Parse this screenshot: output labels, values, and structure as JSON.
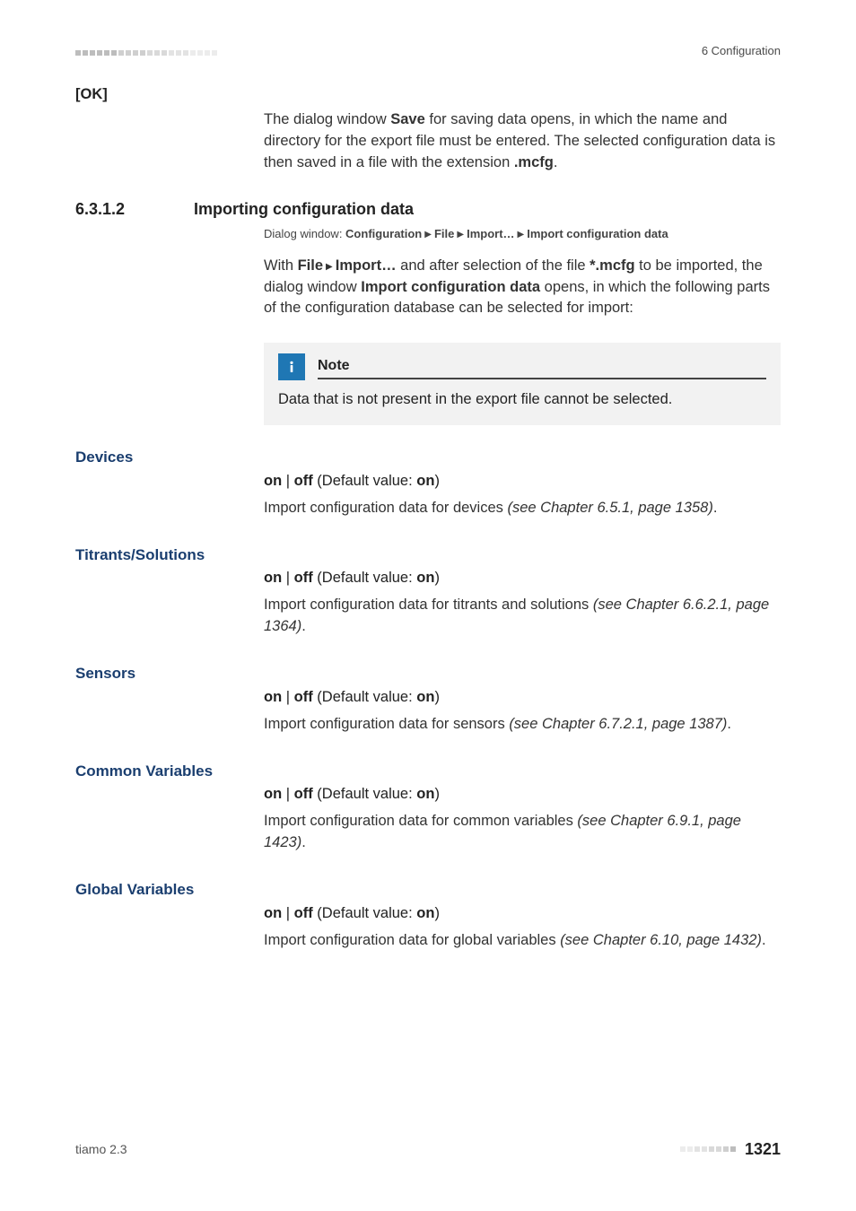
{
  "header": {
    "corner": "6 Configuration"
  },
  "ok": {
    "label": "[OK]",
    "para_parts": [
      "The dialog window ",
      "Save",
      " for saving data opens, in which the name and directory for the export file must be entered. The selected configuration data is then saved in a file with the extension ",
      ".mcfg",
      "."
    ]
  },
  "section": {
    "num": "6.3.1.2",
    "title": "Importing configuration data"
  },
  "dlg": {
    "prefix": "Dialog window: ",
    "p1": "Configuration",
    "p2": "File",
    "p3": "Import…",
    "p4": "Import configuration data"
  },
  "import_para": {
    "a": "With ",
    "b": "File",
    "c": "Import…",
    "d": " and after selection of the file ",
    "e": "*.mcfg",
    "f": " to be imported, the dialog window ",
    "g": "Import configuration data",
    "h": " opens, in which the following parts of the configuration database can be selected for import:"
  },
  "note": {
    "title": "Note",
    "body": "Data that is not present in the export file cannot be selected."
  },
  "onoff": {
    "on": "on",
    "off": "off",
    "deflabel": " (Default value: ",
    "defval": "on",
    "close": ")"
  },
  "fields": {
    "devices": {
      "label": "Devices",
      "p1": "Import configuration data for devices ",
      "p2": "(see Chapter 6.5.1, page 1358)",
      "p3": "."
    },
    "titrants": {
      "label": "Titrants/Solutions",
      "p1": "Import configuration data for titrants and solutions ",
      "p2": "(see Chapter 6.6.2.1, page 1364)",
      "p3": "."
    },
    "sensors": {
      "label": "Sensors",
      "p1": "Import configuration data for sensors ",
      "p2": "(see Chapter 6.7.2.1, page 1387)",
      "p3": "."
    },
    "common": {
      "label": "Common Variables",
      "p1": "Import configuration data for common variables ",
      "p2": "(see Chapter 6.9.1, page 1423)",
      "p3": "."
    },
    "global": {
      "label": "Global Variables",
      "p1": "Import configuration data for global variables ",
      "p2": "(see Chapter 6.10, page 1432)",
      "p3": "."
    }
  },
  "footer": {
    "left": "tiamo 2.3",
    "page": "1321"
  }
}
